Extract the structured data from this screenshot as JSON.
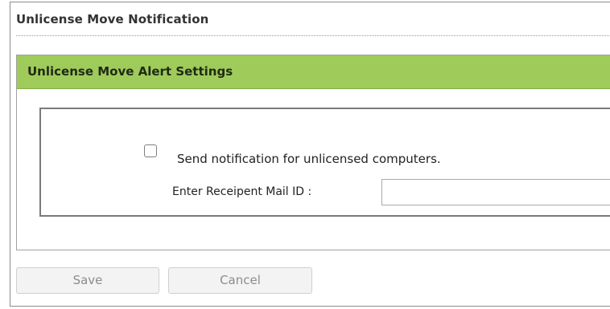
{
  "page": {
    "title": "Unlicense Move Notification"
  },
  "section": {
    "title": "Unlicense Move Alert Settings",
    "header_color": "#9fcb5b"
  },
  "form": {
    "send_notification": {
      "label": "Send notification for unlicensed computers.",
      "checked": false
    },
    "mail_id": {
      "label": "Enter Receipent Mail ID :",
      "value": "",
      "placeholder": ""
    }
  },
  "buttons": {
    "save_label": "Save",
    "cancel_label": "Cancel",
    "disabled": true
  }
}
